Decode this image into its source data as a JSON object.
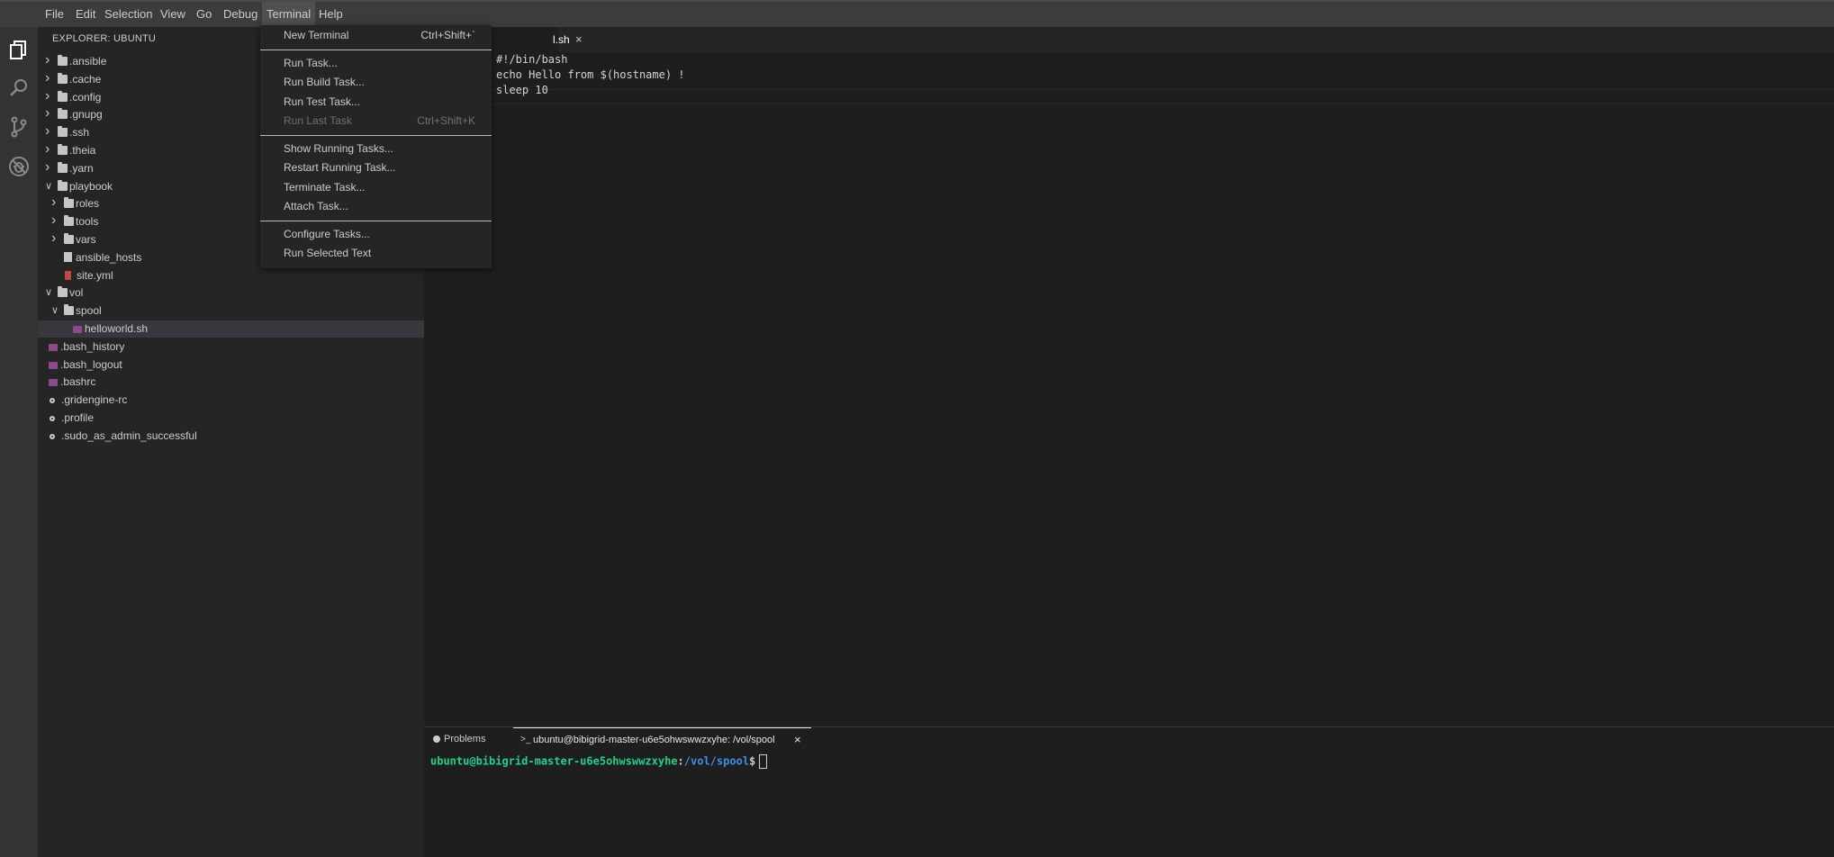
{
  "menubar": {
    "items": [
      "File",
      "Edit",
      "Selection",
      "View",
      "Go",
      "Debug",
      "Terminal",
      "Help"
    ]
  },
  "terminal_menu": {
    "groups": [
      [
        {
          "label": "New Terminal",
          "shortcut": "Ctrl+Shift+`"
        }
      ],
      [
        {
          "label": "Run Task...",
          "shortcut": ""
        },
        {
          "label": "Run Build Task...",
          "shortcut": ""
        },
        {
          "label": "Run Test Task...",
          "shortcut": ""
        },
        {
          "label": "Run Last Task",
          "shortcut": "Ctrl+Shift+K",
          "disabled": true
        }
      ],
      [
        {
          "label": "Show Running Tasks...",
          "shortcut": ""
        },
        {
          "label": "Restart Running Task...",
          "shortcut": ""
        },
        {
          "label": "Terminate Task...",
          "shortcut": ""
        },
        {
          "label": "Attach Task...",
          "shortcut": ""
        }
      ],
      [
        {
          "label": "Configure Tasks...",
          "shortcut": ""
        },
        {
          "label": "Run Selected Text",
          "shortcut": ""
        }
      ]
    ]
  },
  "activitybar": {
    "icons": [
      "explorer-icon",
      "search-icon",
      "source-control-icon",
      "debug-icon"
    ]
  },
  "explorer": {
    "title": "EXPLORER: UBUNTU",
    "items": [
      {
        "label": ".ansible",
        "type": "folder",
        "depth": 0,
        "expanded": false
      },
      {
        "label": ".cache",
        "type": "folder",
        "depth": 0,
        "expanded": false
      },
      {
        "label": ".config",
        "type": "folder",
        "depth": 0,
        "expanded": false
      },
      {
        "label": ".gnupg",
        "type": "folder",
        "depth": 0,
        "expanded": false
      },
      {
        "label": ".ssh",
        "type": "folder",
        "depth": 0,
        "expanded": false
      },
      {
        "label": ".theia",
        "type": "folder",
        "depth": 0,
        "expanded": false
      },
      {
        "label": ".yarn",
        "type": "folder",
        "depth": 0,
        "expanded": false
      },
      {
        "label": "playbook",
        "type": "folder",
        "depth": 0,
        "expanded": true
      },
      {
        "label": "roles",
        "type": "folder",
        "depth": 1,
        "expanded": false
      },
      {
        "label": "tools",
        "type": "folder",
        "depth": 1,
        "expanded": false
      },
      {
        "label": "vars",
        "type": "folder",
        "depth": 1,
        "expanded": false
      },
      {
        "label": "ansible_hosts",
        "type": "file",
        "depth": 1
      },
      {
        "label": "site.yml",
        "type": "yml",
        "depth": 1
      },
      {
        "label": "vol",
        "type": "folder",
        "depth": 0,
        "expanded": true
      },
      {
        "label": "spool",
        "type": "folder",
        "depth": 1,
        "expanded": true
      },
      {
        "label": "helloworld.sh",
        "type": "sh",
        "depth": 2,
        "selected": true
      },
      {
        "label": ".bash_history",
        "type": "sh",
        "depth": 0
      },
      {
        "label": ".bash_logout",
        "type": "sh",
        "depth": 0
      },
      {
        "label": ".bashrc",
        "type": "sh",
        "depth": 0
      },
      {
        "label": ".gridengine-rc",
        "type": "gear",
        "depth": 0
      },
      {
        "label": ".profile",
        "type": "gear",
        "depth": 0
      },
      {
        "label": ".sudo_as_admin_successful",
        "type": "gear",
        "depth": 0
      }
    ]
  },
  "editor": {
    "tab_label": "l.sh",
    "tab_close": "×",
    "lines": [
      "#!/bin/bash",
      "echo Hello from $(hostname) !",
      "sleep 10"
    ]
  },
  "panel": {
    "problems_label": "Problems",
    "terminal_tab_label": "ubuntu@bibigrid-master-u6e5ohwswwzxyhe: /vol/spool",
    "terminal_close": "×",
    "prompt_user": "ubuntu@bibigrid-master-u6e5ohwswwzxyhe",
    "prompt_sep": ":",
    "prompt_path": "/vol/spool",
    "prompt_symbol": "$"
  },
  "colors": {
    "prompt_user": "#23d18b",
    "prompt_path": "#3b8eea"
  }
}
